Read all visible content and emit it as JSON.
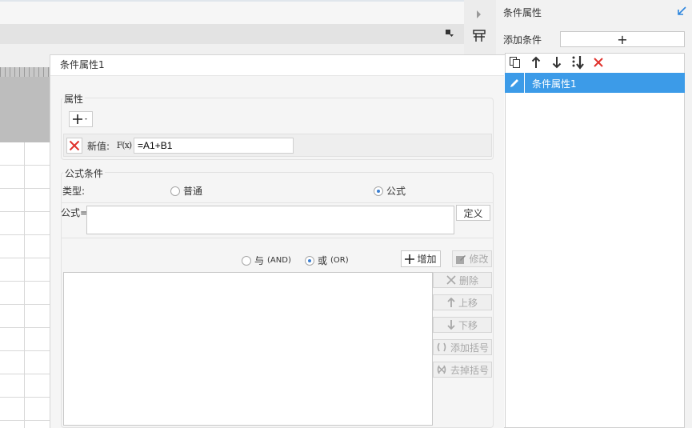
{
  "right_panel": {
    "title": "条件属性",
    "add_condition_label": "添加条件",
    "add_button_symbol": "+",
    "toolbar_icons": [
      "copy-icon",
      "arrow-up-icon",
      "arrow-down-icon",
      "sort-down-icon",
      "delete-icon"
    ],
    "items": [
      {
        "label": "条件属性1",
        "selected": true
      }
    ],
    "accent_color": "#3c9be8"
  },
  "dialog": {
    "title": "条件属性1",
    "property": {
      "group_label": "属性",
      "add_symbol": "+",
      "new_value_label": "新值:",
      "fx_label": "F(x)",
      "new_value": "=A1+B1"
    },
    "formula_condition": {
      "group_label": "公式条件",
      "type_label": "类型:",
      "type_options": [
        {
          "label": "普通",
          "selected": false
        },
        {
          "label": "公式",
          "selected": true
        }
      ],
      "formula_label": "公式=",
      "formula_value": "",
      "define_button": "定义",
      "logic_options": [
        {
          "cn": "与",
          "en": "(AND)",
          "selected": false
        },
        {
          "cn": "或",
          "en": "(OR)",
          "selected": true
        }
      ],
      "add_button": "增加",
      "edit_button": "修改",
      "side_buttons": {
        "delete": "删除",
        "move_up": "上移",
        "move_down": "下移",
        "add_parens": "添加括号",
        "remove_parens": "去掉括号"
      }
    }
  }
}
